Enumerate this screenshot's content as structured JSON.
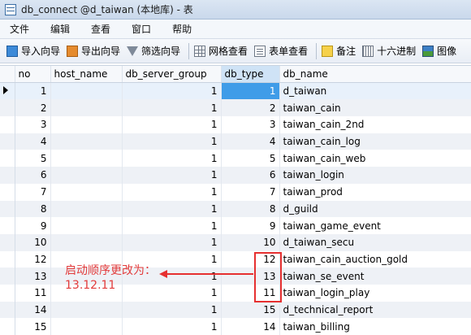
{
  "window": {
    "title": "db_connect @d_taiwan (本地库) - 表"
  },
  "menu": [
    "文件",
    "编辑",
    "查看",
    "窗口",
    "帮助"
  ],
  "toolbar": [
    {
      "icon": "import-wizard-icon",
      "label": "导入向导"
    },
    {
      "icon": "export-wizard-icon",
      "label": "导出向导"
    },
    {
      "icon": "filter-wizard-icon",
      "label": "筛选向导"
    },
    {
      "icon": "grid-view-icon",
      "label": "网格查看"
    },
    {
      "icon": "form-view-icon",
      "label": "表单查看"
    },
    {
      "icon": "memo-icon",
      "label": "备注"
    },
    {
      "icon": "hex-icon",
      "label": "十六进制"
    },
    {
      "icon": "image-icon",
      "label": "图像"
    }
  ],
  "table": {
    "columns": [
      "no",
      "host_name",
      "db_server_group",
      "db_type",
      "db_name"
    ],
    "rows": [
      {
        "no": "1",
        "host_name": "",
        "db_server_group": "1",
        "db_type": "1",
        "db_name": "d_taiwan"
      },
      {
        "no": "2",
        "host_name": "",
        "db_server_group": "1",
        "db_type": "2",
        "db_name": "taiwan_cain"
      },
      {
        "no": "3",
        "host_name": "",
        "db_server_group": "1",
        "db_type": "3",
        "db_name": "taiwan_cain_2nd"
      },
      {
        "no": "4",
        "host_name": "",
        "db_server_group": "1",
        "db_type": "4",
        "db_name": "taiwan_cain_log"
      },
      {
        "no": "5",
        "host_name": "",
        "db_server_group": "1",
        "db_type": "5",
        "db_name": "taiwan_cain_web"
      },
      {
        "no": "6",
        "host_name": "",
        "db_server_group": "1",
        "db_type": "6",
        "db_name": "taiwan_login"
      },
      {
        "no": "7",
        "host_name": "",
        "db_server_group": "1",
        "db_type": "7",
        "db_name": "taiwan_prod"
      },
      {
        "no": "8",
        "host_name": "",
        "db_server_group": "1",
        "db_type": "8",
        "db_name": "d_guild"
      },
      {
        "no": "9",
        "host_name": "",
        "db_server_group": "1",
        "db_type": "9",
        "db_name": "taiwan_game_event"
      },
      {
        "no": "10",
        "host_name": "",
        "db_server_group": "1",
        "db_type": "10",
        "db_name": "d_taiwan_secu"
      },
      {
        "no": "12",
        "host_name": "",
        "db_server_group": "1",
        "db_type": "12",
        "db_name": "taiwan_cain_auction_gold"
      },
      {
        "no": "13",
        "host_name": "",
        "db_server_group": "1",
        "db_type": "13",
        "db_name": "taiwan_se_event"
      },
      {
        "no": "11",
        "host_name": "",
        "db_server_group": "1",
        "db_type": "11",
        "db_name": "taiwan_login_play"
      },
      {
        "no": "14",
        "host_name": "",
        "db_server_group": "1",
        "db_type": "15",
        "db_name": "d_technical_report"
      },
      {
        "no": "15",
        "host_name": "",
        "db_server_group": "1",
        "db_type": "14",
        "db_name": "taiwan_billing"
      }
    ],
    "selected_row": 0,
    "active_column": "db_type"
  },
  "annotation": {
    "line1": "启动顺序更改为：",
    "line2": "13.12.11",
    "color": "#e63030"
  }
}
